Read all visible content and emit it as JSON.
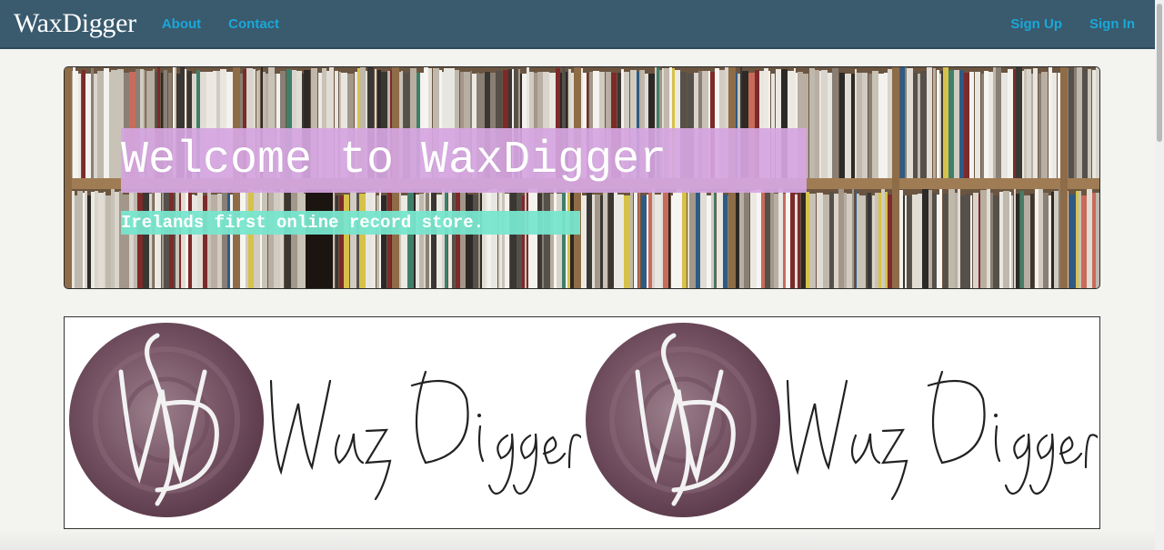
{
  "navbar": {
    "brand": "WaxDigger",
    "left_links": [
      {
        "label": "About"
      },
      {
        "label": "Contact"
      }
    ],
    "right_links": [
      {
        "label": "Sign Up"
      },
      {
        "label": "Sign In"
      }
    ],
    "background_color": "#3a5a6e",
    "link_color": "#1aa8d8"
  },
  "hero": {
    "title": "Welcome to WaxDigger",
    "subtitle": "Irelands first online record store.",
    "title_highlight_color": "#d5a6e1",
    "subtitle_highlight_color": "#78e6cd",
    "background_image": "record-shelves-photo"
  },
  "banner": {
    "logo_text": "Wax Digger",
    "logo_monogram": "WD",
    "repeat_count": 2,
    "circle_color": "#7d5a6a"
  }
}
